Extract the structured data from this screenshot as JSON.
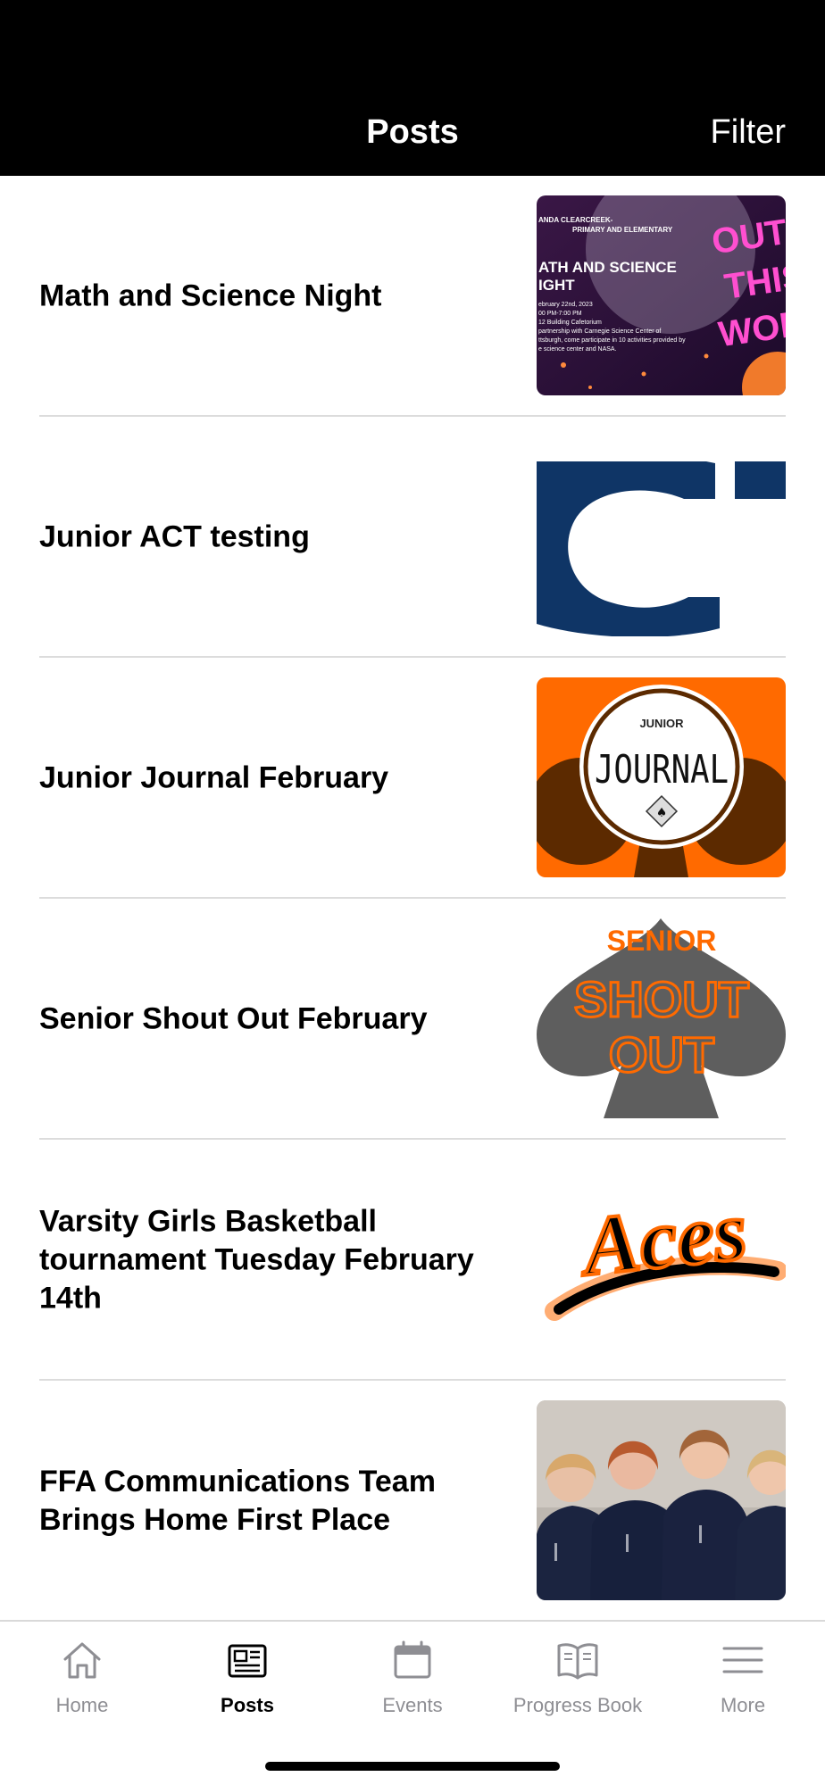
{
  "header": {
    "title": "Posts",
    "filter_label": "Filter"
  },
  "posts": [
    {
      "title": "Math and Science Night",
      "thumb": {
        "lines": [
          "ANDA CLEARCREEK-",
          "PRIMARY AND ELEMENTARY",
          "ATH AND SCIENCE",
          "IGHT",
          "ebruary 22nd, 2023",
          "00 PM-7:00 PM",
          "12 Building Cafetorium",
          "partnership with Carnegie Science Center of",
          "ttsburgh, come participate in 10 activities provided by",
          "e science center and NASA."
        ],
        "side_text": [
          "OUT",
          "THIS",
          "WORL"
        ]
      }
    },
    {
      "title": "Junior ACT testing",
      "thumb": {
        "letter": "C"
      }
    },
    {
      "title": "Junior Journal February",
      "thumb": {
        "top": "JUNIOR",
        "main": "JOURNAL"
      }
    },
    {
      "title": "Senior Shout Out February",
      "thumb": {
        "top": "SENIOR",
        "line1": "SHOUT",
        "line2": "OUT"
      }
    },
    {
      "title": "Varsity Girls Basketball tournament Tuesday February 14th",
      "thumb": {
        "word": "Aces"
      }
    },
    {
      "title": "FFA Communications Team Brings Home First Place",
      "thumb": {}
    }
  ],
  "tabs": [
    {
      "label": "Home",
      "icon": "home-icon",
      "active": false
    },
    {
      "label": "Posts",
      "icon": "newspaper-icon",
      "active": true
    },
    {
      "label": "Events",
      "icon": "calendar-icon",
      "active": false
    },
    {
      "label": "Progress Book",
      "icon": "book-icon",
      "active": false
    },
    {
      "label": "More",
      "icon": "menu-icon",
      "active": false
    }
  ],
  "colors": {
    "header_bg": "#000000",
    "accent_orange": "#ff6a00",
    "navy": "#0f3566",
    "tab_inactive": "#8e8e93"
  }
}
